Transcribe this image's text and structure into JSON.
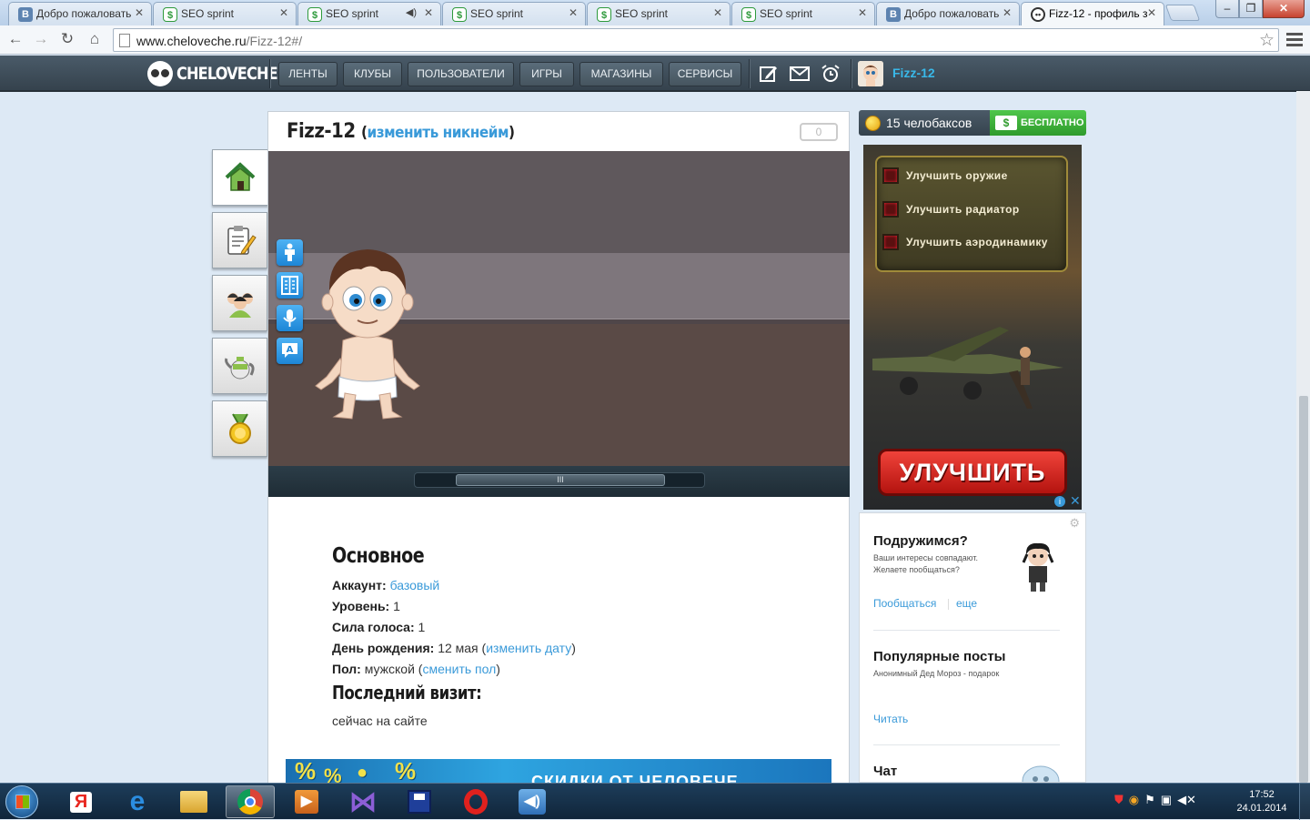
{
  "browser": {
    "tabs": [
      {
        "label": "Добро пожаловать",
        "icon": "vk-icon"
      },
      {
        "label": "SEO sprint",
        "icon": "seo-sprint-icon"
      },
      {
        "label": "SEO sprint",
        "icon": "seo-sprint-icon",
        "sound": true
      },
      {
        "label": "SEO sprint",
        "icon": "seo-sprint-icon"
      },
      {
        "label": "SEO sprint",
        "icon": "seo-sprint-icon"
      },
      {
        "label": "SEO sprint",
        "icon": "seo-sprint-icon"
      },
      {
        "label": "Добро пожаловать",
        "icon": "vk-icon"
      },
      {
        "label": "Fizz-12 - профиль з",
        "icon": "cheloveche-icon",
        "active": true
      }
    ],
    "url_host": "www.cheloveche.ru",
    "url_path": "/Fizz-12#/"
  },
  "header": {
    "logo_text": "CHELOVECHE",
    "nav": [
      "ЛЕНТЫ",
      "КЛУБЫ",
      "ПОЛЬЗОВАТЕЛИ",
      "ИГРЫ",
      "МАГАЗИНЫ",
      "СЕРВИСЫ"
    ],
    "icons": [
      "compose-icon",
      "mail-icon",
      "alarm-clock-icon"
    ],
    "username": "Fizz-12"
  },
  "sidebar": {
    "items": [
      "home-icon",
      "notepad-icon",
      "friends-icon",
      "teapot-icon",
      "medal-icon"
    ]
  },
  "profile": {
    "name": "Fizz-12",
    "change_nick_label": "изменить никнейм",
    "score": "0",
    "tools": [
      "body-icon",
      "wardrobe-icon",
      "microphone-icon",
      "speech-bubble-icon"
    ],
    "scrub_label": "III",
    "section_main": "Основное",
    "account_label": "Аккаунт:",
    "account_value": "базовый",
    "level_label": "Уровень:",
    "level_value": "1",
    "voice_label": "Сила голоса:",
    "voice_value": "1",
    "birthday_label": "День рождения:",
    "birthday_value": "12 мая",
    "birthday_link": "изменить дату",
    "gender_label": "Пол:",
    "gender_value": "мужской",
    "gender_link": "сменить пол",
    "last_visit_title": "Последний визит:",
    "last_visit_value": "сейчас на сайте",
    "banner_text": "СКИДКИ ОТ ЧЕЛОВЕЧЕ"
  },
  "wallet": {
    "bucks": "15 челобаксов",
    "free_label": "БЕСПЛАТНО"
  },
  "ad": {
    "options": [
      "Улучшить оружие",
      "Улучшить радиатор",
      "Улучшить аэродинамику"
    ],
    "cta": "УЛУЧШИТЬ"
  },
  "widget": {
    "friend_title": "Подружимся?",
    "friend_text_1": "Ваши интересы совпадают.",
    "friend_text_2": "Желаете пообщаться?",
    "friend_link_1": "Пообщаться",
    "friend_link_2": "еще",
    "popular_title": "Популярные посты",
    "popular_text": "Анонимный Дед Мороз - подарок",
    "read_link": "Читать",
    "chat_title": "Чат"
  },
  "taskbar": {
    "apps": [
      "yandex-icon",
      "internet-explorer-icon",
      "file-explorer-icon",
      "chrome-icon",
      "media-player-icon",
      "visual-studio-icon",
      "save-disk-icon",
      "opera-icon",
      "speaker-app-icon"
    ],
    "time": "17:52",
    "date": "24.01.2014"
  }
}
